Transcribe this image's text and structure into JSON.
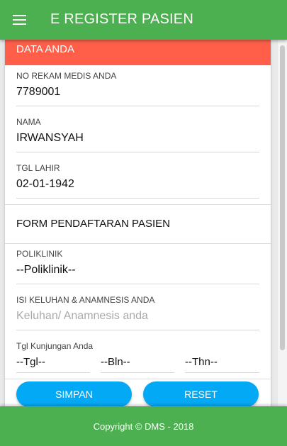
{
  "app": {
    "title": "E REGISTER PASIEN"
  },
  "data_anda": {
    "header": "DATA ANDA",
    "fields": [
      {
        "label": "NO REKAM MEDIS ANDA",
        "value": "7789001"
      },
      {
        "label": "NAMA",
        "value": "IRWANSYAH"
      },
      {
        "label": "TGL LAHIR",
        "value": "02-01-1942"
      }
    ]
  },
  "form": {
    "title": "FORM PENDAFTARAN PASIEN",
    "poliklinik": {
      "label": "POLIKLINIK",
      "value": "--Poliklinik--"
    },
    "keluhan": {
      "label": "ISI KELUHAN & ANAMNESIS ANDA",
      "placeholder": "Keluhan/ Anamnesis anda"
    },
    "tgl_kunjungan": {
      "label": "Tgl Kunjungan Anda",
      "day": "--Tgl--",
      "month": "--Bln--",
      "year": "--Thn--"
    },
    "buttons": {
      "simpan": "SIMPAN",
      "reset": "RESET"
    }
  },
  "footer": {
    "text": "Copyright © DMS - 2018"
  },
  "colors": {
    "appbar": "#4caf50",
    "header": "#ff5f49",
    "button": "#03a9f4"
  },
  "icons": {
    "menu": "hamburger-menu-icon"
  }
}
